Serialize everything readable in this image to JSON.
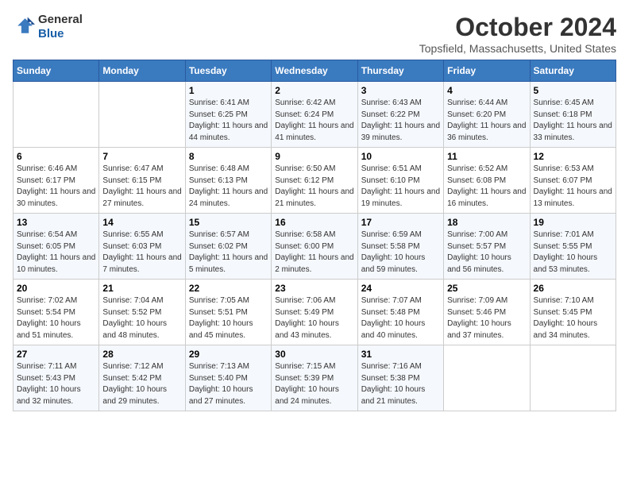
{
  "header": {
    "logo_line1": "General",
    "logo_line2": "Blue",
    "month": "October 2024",
    "location": "Topsfield, Massachusetts, United States"
  },
  "days_of_week": [
    "Sunday",
    "Monday",
    "Tuesday",
    "Wednesday",
    "Thursday",
    "Friday",
    "Saturday"
  ],
  "weeks": [
    [
      {
        "day": "",
        "detail": ""
      },
      {
        "day": "",
        "detail": ""
      },
      {
        "day": "1",
        "detail": "Sunrise: 6:41 AM\nSunset: 6:25 PM\nDaylight: 11 hours and 44 minutes."
      },
      {
        "day": "2",
        "detail": "Sunrise: 6:42 AM\nSunset: 6:24 PM\nDaylight: 11 hours and 41 minutes."
      },
      {
        "day": "3",
        "detail": "Sunrise: 6:43 AM\nSunset: 6:22 PM\nDaylight: 11 hours and 39 minutes."
      },
      {
        "day": "4",
        "detail": "Sunrise: 6:44 AM\nSunset: 6:20 PM\nDaylight: 11 hours and 36 minutes."
      },
      {
        "day": "5",
        "detail": "Sunrise: 6:45 AM\nSunset: 6:18 PM\nDaylight: 11 hours and 33 minutes."
      }
    ],
    [
      {
        "day": "6",
        "detail": "Sunrise: 6:46 AM\nSunset: 6:17 PM\nDaylight: 11 hours and 30 minutes."
      },
      {
        "day": "7",
        "detail": "Sunrise: 6:47 AM\nSunset: 6:15 PM\nDaylight: 11 hours and 27 minutes."
      },
      {
        "day": "8",
        "detail": "Sunrise: 6:48 AM\nSunset: 6:13 PM\nDaylight: 11 hours and 24 minutes."
      },
      {
        "day": "9",
        "detail": "Sunrise: 6:50 AM\nSunset: 6:12 PM\nDaylight: 11 hours and 21 minutes."
      },
      {
        "day": "10",
        "detail": "Sunrise: 6:51 AM\nSunset: 6:10 PM\nDaylight: 11 hours and 19 minutes."
      },
      {
        "day": "11",
        "detail": "Sunrise: 6:52 AM\nSunset: 6:08 PM\nDaylight: 11 hours and 16 minutes."
      },
      {
        "day": "12",
        "detail": "Sunrise: 6:53 AM\nSunset: 6:07 PM\nDaylight: 11 hours and 13 minutes."
      }
    ],
    [
      {
        "day": "13",
        "detail": "Sunrise: 6:54 AM\nSunset: 6:05 PM\nDaylight: 11 hours and 10 minutes."
      },
      {
        "day": "14",
        "detail": "Sunrise: 6:55 AM\nSunset: 6:03 PM\nDaylight: 11 hours and 7 minutes."
      },
      {
        "day": "15",
        "detail": "Sunrise: 6:57 AM\nSunset: 6:02 PM\nDaylight: 11 hours and 5 minutes."
      },
      {
        "day": "16",
        "detail": "Sunrise: 6:58 AM\nSunset: 6:00 PM\nDaylight: 11 hours and 2 minutes."
      },
      {
        "day": "17",
        "detail": "Sunrise: 6:59 AM\nSunset: 5:58 PM\nDaylight: 10 hours and 59 minutes."
      },
      {
        "day": "18",
        "detail": "Sunrise: 7:00 AM\nSunset: 5:57 PM\nDaylight: 10 hours and 56 minutes."
      },
      {
        "day": "19",
        "detail": "Sunrise: 7:01 AM\nSunset: 5:55 PM\nDaylight: 10 hours and 53 minutes."
      }
    ],
    [
      {
        "day": "20",
        "detail": "Sunrise: 7:02 AM\nSunset: 5:54 PM\nDaylight: 10 hours and 51 minutes."
      },
      {
        "day": "21",
        "detail": "Sunrise: 7:04 AM\nSunset: 5:52 PM\nDaylight: 10 hours and 48 minutes."
      },
      {
        "day": "22",
        "detail": "Sunrise: 7:05 AM\nSunset: 5:51 PM\nDaylight: 10 hours and 45 minutes."
      },
      {
        "day": "23",
        "detail": "Sunrise: 7:06 AM\nSunset: 5:49 PM\nDaylight: 10 hours and 43 minutes."
      },
      {
        "day": "24",
        "detail": "Sunrise: 7:07 AM\nSunset: 5:48 PM\nDaylight: 10 hours and 40 minutes."
      },
      {
        "day": "25",
        "detail": "Sunrise: 7:09 AM\nSunset: 5:46 PM\nDaylight: 10 hours and 37 minutes."
      },
      {
        "day": "26",
        "detail": "Sunrise: 7:10 AM\nSunset: 5:45 PM\nDaylight: 10 hours and 34 minutes."
      }
    ],
    [
      {
        "day": "27",
        "detail": "Sunrise: 7:11 AM\nSunset: 5:43 PM\nDaylight: 10 hours and 32 minutes."
      },
      {
        "day": "28",
        "detail": "Sunrise: 7:12 AM\nSunset: 5:42 PM\nDaylight: 10 hours and 29 minutes."
      },
      {
        "day": "29",
        "detail": "Sunrise: 7:13 AM\nSunset: 5:40 PM\nDaylight: 10 hours and 27 minutes."
      },
      {
        "day": "30",
        "detail": "Sunrise: 7:15 AM\nSunset: 5:39 PM\nDaylight: 10 hours and 24 minutes."
      },
      {
        "day": "31",
        "detail": "Sunrise: 7:16 AM\nSunset: 5:38 PM\nDaylight: 10 hours and 21 minutes."
      },
      {
        "day": "",
        "detail": ""
      },
      {
        "day": "",
        "detail": ""
      }
    ]
  ]
}
